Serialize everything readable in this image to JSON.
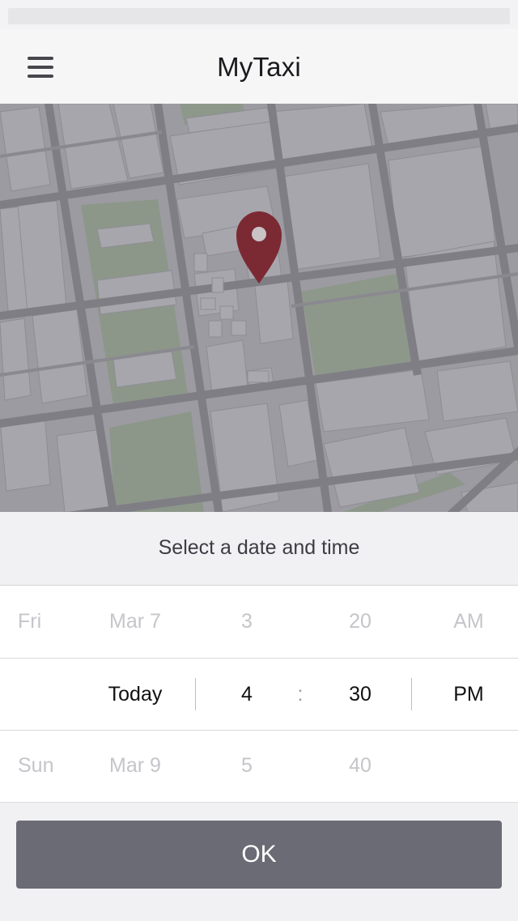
{
  "header": {
    "title": "MyTaxi",
    "menu_icon": "hamburger-menu-icon"
  },
  "map": {
    "pin_icon": "location-pin-icon",
    "pin_color": "#7b2a34"
  },
  "prompt": {
    "text": "Select a date and time"
  },
  "picker": {
    "day_column": {
      "above": "Fri",
      "below": "Sun"
    },
    "date_column": {
      "above": "Mar 7",
      "selected": "Today",
      "below": "Mar 9"
    },
    "hour_column": {
      "above": "3",
      "selected": "4",
      "below": "5"
    },
    "separator": ":",
    "minute_column": {
      "above": "20",
      "selected": "30",
      "below": "40"
    },
    "period_column": {
      "above": "AM",
      "selected": "PM"
    }
  },
  "footer": {
    "ok_label": "OK",
    "button_color": "#6b6b75"
  }
}
